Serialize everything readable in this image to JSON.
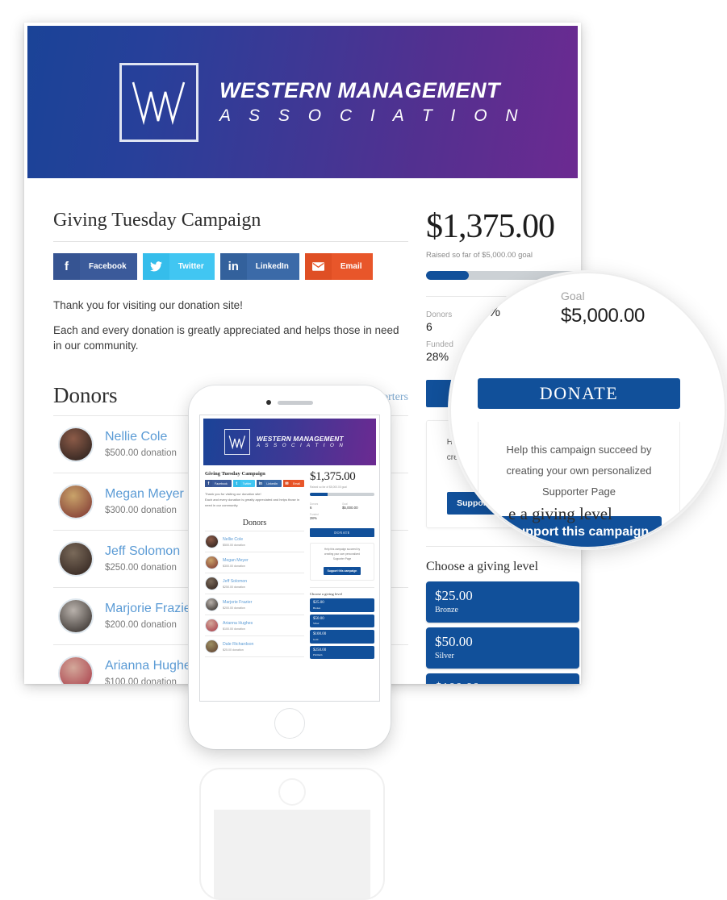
{
  "brand": {
    "name_line1": "WESTERN MANAGEMENT",
    "name_line2": "A S S O C I A T I O N",
    "monogram": "WM",
    "gradient_start": "#1a4397",
    "gradient_end": "#6c2a91"
  },
  "campaign": {
    "title": "Giving Tuesday Campaign",
    "intro_line1": "Thank you for visiting our donation site!",
    "intro_line2": "Each and every donation is greatly appreciated and helps those in need in our community."
  },
  "social": [
    {
      "label": "Facebook",
      "icon": "facebook-icon",
      "glyph": "f",
      "color": "#3b5a9a"
    },
    {
      "label": "Twitter",
      "icon": "twitter-icon",
      "glyph": "✉",
      "color": "#41c6f2"
    },
    {
      "label": "LinkedIn",
      "icon": "linkedin-icon",
      "glyph": "in",
      "color": "#3b6aa8"
    },
    {
      "label": "Email",
      "icon": "email-icon",
      "glyph": "✉",
      "color": "#e8562a"
    }
  ],
  "progress": {
    "amount_raised": "$1,375.00",
    "raised_caption": "Raised so far of $5,000.00 goal",
    "percent_filled": 28,
    "bar_color": "#11509a",
    "stats": {
      "donors_label": "Donors",
      "donors_value": "6",
      "funded_label": "Funded",
      "funded_value": "28%",
      "goal_label": "Goal",
      "goal_value": "$5,000.00"
    },
    "donate_label": "DONATE"
  },
  "supporter": {
    "text_line1": "Help this campaign succeed by",
    "text_line2": "creating your own personalized",
    "text_line3": "Supporter Page",
    "button_label": "Support this campaign"
  },
  "giving": {
    "heading": "Choose a giving level",
    "levels": [
      {
        "amount": "$25.00",
        "name": "Bronze"
      },
      {
        "amount": "$50.00",
        "name": "Silver"
      },
      {
        "amount": "$100.00",
        "name": "Gold"
      },
      {
        "amount": "$250.00",
        "name": "Platinum"
      }
    ]
  },
  "donors_section": {
    "heading": "Donors",
    "view_link": "View Supporters",
    "donation_suffix": "donation",
    "list": [
      {
        "name": "Nellie Cole",
        "amount": "$500.00 donation",
        "avatar_from": "#8c5b48",
        "avatar_to": "#3a2a24"
      },
      {
        "name": "Megan Meyer",
        "amount": "$300.00 donation",
        "avatar_from": "#c9a36a",
        "avatar_to": "#8c4a3c"
      },
      {
        "name": "Jeff Solomon",
        "amount": "$250.00 donation",
        "avatar_from": "#7a6a5a",
        "avatar_to": "#3d2f28"
      },
      {
        "name": "Marjorie Frazier",
        "amount": "$200.00 donation",
        "avatar_from": "#b9b2ac",
        "avatar_to": "#4a4440"
      },
      {
        "name": "Arianna Hughes",
        "amount": "$100.00 donation",
        "avatar_from": "#d3a89a",
        "avatar_to": "#b04f57"
      },
      {
        "name": "Dale Richardson",
        "amount": "$25.00 donation",
        "avatar_from": "#9c8f62",
        "avatar_to": "#6b4f3a"
      }
    ]
  },
  "magnifier": {
    "goal_label": "Goal",
    "goal_value": "$5,000.00",
    "percent_fragment": "%",
    "donate_label": "DONATE",
    "support_text_line1": "Help this campaign succeed by",
    "support_text_line2": "creating your own personalized",
    "support_text_line3": "Supporter Page",
    "support_button": "Support this campaign",
    "giving_fragment": "e a giving level"
  }
}
